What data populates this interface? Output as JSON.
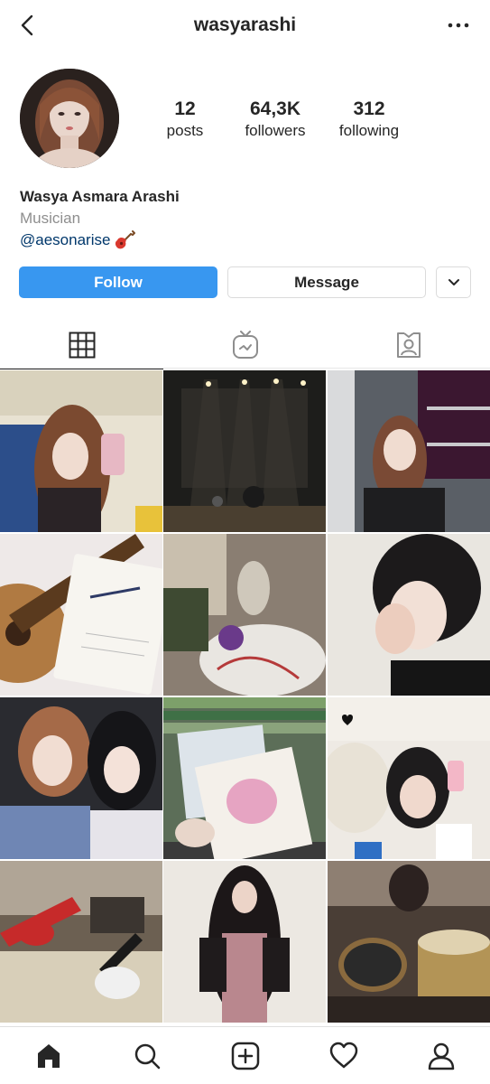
{
  "header": {
    "username": "wasyarashi",
    "back_icon": "chevron-left-icon",
    "more_icon": "more-horizontal-icon"
  },
  "profile": {
    "stats": [
      {
        "value": "12",
        "label": "posts"
      },
      {
        "value": "64,3K",
        "label": "followers"
      },
      {
        "value": "312",
        "label": "following"
      }
    ],
    "name": "Wasya Asmara Arashi",
    "category": "Musician",
    "link": "@aesonarise",
    "link_emoji": "guitar-icon"
  },
  "actions": {
    "follow": "Follow",
    "message": "Message",
    "dropdown_icon": "chevron-down-icon"
  },
  "tabs": [
    {
      "icon": "grid-icon",
      "active": true
    },
    {
      "icon": "igtv-icon",
      "active": false
    },
    {
      "icon": "tagged-icon",
      "active": false
    }
  ],
  "bottom_nav": [
    "home-icon",
    "search-icon",
    "add-post-icon",
    "heart-icon",
    "profile-icon"
  ],
  "colors": {
    "accent": "#3897f0",
    "link": "#00376b",
    "secondary_text": "#8e8e8e"
  }
}
